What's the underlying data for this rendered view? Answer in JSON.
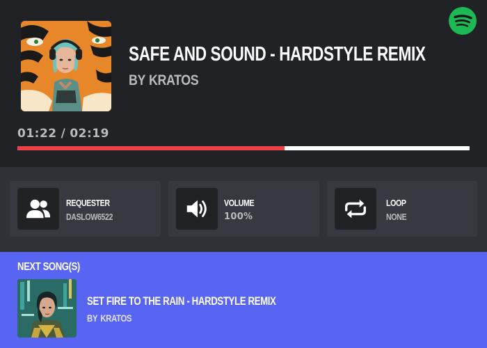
{
  "now_playing": {
    "title": "Safe and Sound - Hardstyle Remix",
    "by_prefix": "By",
    "artist": "Kratos",
    "cover_icon": "album-art-tiger-woman"
  },
  "spotify": {
    "icon": "spotify-icon",
    "color": "#1db954"
  },
  "playback": {
    "current_time": "01:22",
    "separator": "/",
    "total_time": "02:19",
    "progress_fraction": 0.59,
    "progress_color": "#ed4245",
    "track_color": "#ffffff"
  },
  "stats": {
    "requester": {
      "label": "Requester",
      "value": "DasLow6522",
      "icon": "users-icon"
    },
    "volume": {
      "label": "Volume",
      "value": "100%",
      "icon": "volume-icon"
    },
    "loop": {
      "label": "Loop",
      "value": "None",
      "icon": "repeat-icon"
    }
  },
  "next": {
    "heading": "Next Song(s)",
    "items": [
      {
        "title": "Set Fire to the Rain - Hardstyle Remix",
        "by_prefix": "By",
        "artist": "Kratos",
        "cover_icon": "album-art-cyberpunk-woman"
      }
    ]
  },
  "colors": {
    "background": "#202225",
    "stats_background": "#2f3136",
    "card_background": "#36393f",
    "next_background": "#5865f2"
  }
}
